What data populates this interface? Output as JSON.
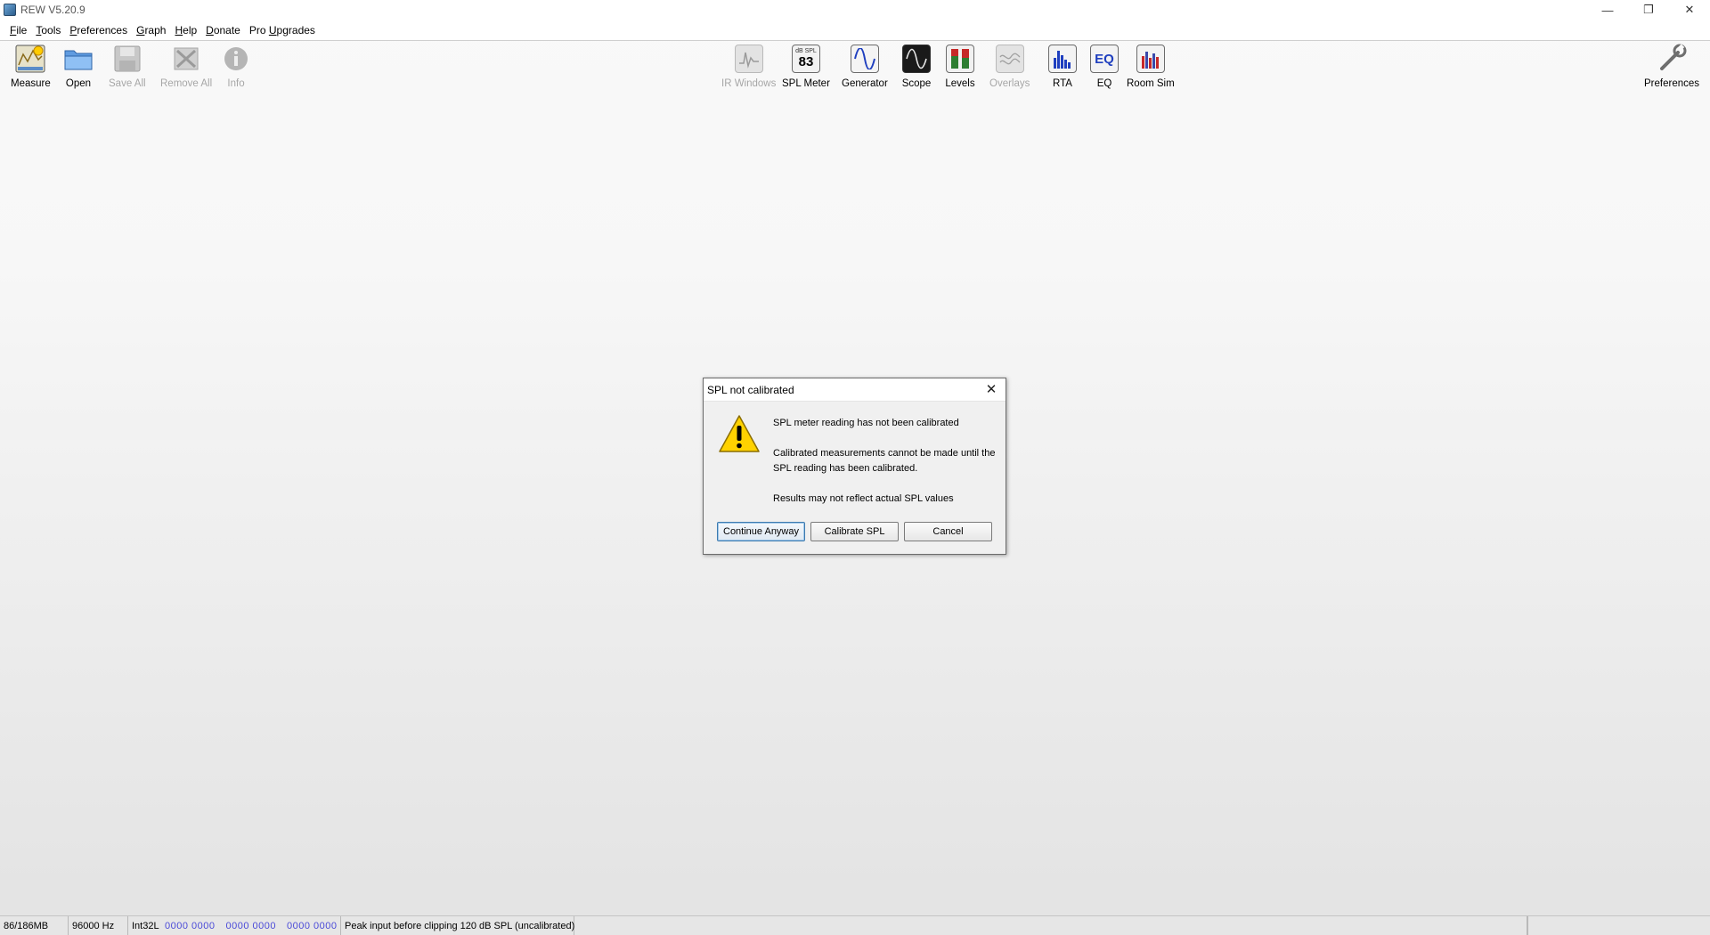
{
  "window": {
    "title": "REW V5.20.9"
  },
  "menu": [
    {
      "mnemonic": "F",
      "rest": "ile"
    },
    {
      "mnemonic": "T",
      "rest": "ools"
    },
    {
      "mnemonic": "P",
      "rest": "references"
    },
    {
      "mnemonic": "G",
      "rest": "raph"
    },
    {
      "mnemonic": "H",
      "rest": "elp"
    },
    {
      "mnemonic": "D",
      "rest": "onate"
    },
    {
      "pre": "Pro ",
      "mnemonic": "U",
      "rest": "pgrades"
    }
  ],
  "toolbar": {
    "measure": "Measure",
    "open": "Open",
    "save_all": "Save All",
    "remove_all": "Remove All",
    "info": "Info",
    "ir_windows": "IR Windows",
    "spl_meter": "SPL Meter",
    "spl_meter_unit": "dB SPL",
    "spl_meter_value": "83",
    "generator": "Generator",
    "scope": "Scope",
    "levels": "Levels",
    "overlays": "Overlays",
    "rta": "RTA",
    "eq": "EQ",
    "eq_icon_text": "EQ",
    "room_sim": "Room Sim",
    "preferences": "Preferences"
  },
  "dialog": {
    "title": "SPL not calibrated",
    "line1": "SPL meter reading has not been calibrated",
    "line2": "Calibrated measurements cannot be made until the SPL reading has been calibrated.",
    "line3": "Results may not reflect actual SPL values",
    "continue_label": "Continue Anyway",
    "calibrate_label": "Calibrate SPL",
    "cancel_label": "Cancel"
  },
  "status": {
    "memory": "86/186MB",
    "sample_rate": "96000 Hz",
    "format": "Int32L",
    "bits": [
      "0000 0000",
      "0000 0000",
      "0000 0000"
    ],
    "peak": "Peak input before clipping 120 dB SPL (uncalibrated)"
  },
  "colors": {
    "accent_blue": "#1f3fbf",
    "warning_yellow": "#ffd200",
    "status_bits_blue": "#4a4ad8"
  }
}
